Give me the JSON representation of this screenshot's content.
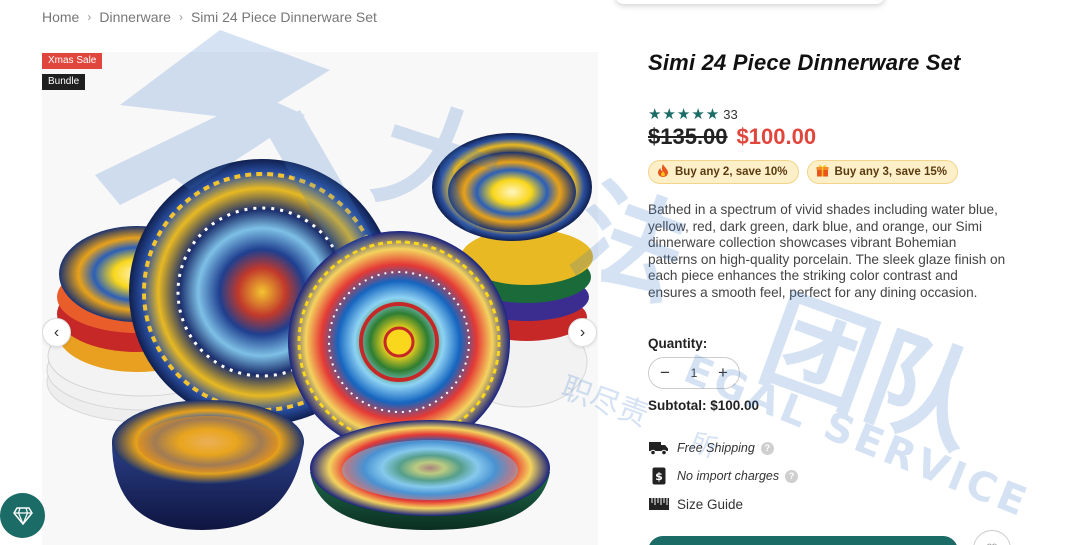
{
  "breadcrumb": {
    "items": [
      "Home",
      "Dinnerware"
    ],
    "current": "Simi 24 Piece Dinnerware Set"
  },
  "gallery": {
    "badges": {
      "sale": "Xmas Sale",
      "bundle": "Bundle"
    },
    "prev_icon": "chevron-left-icon",
    "next_icon": "chevron-right-icon"
  },
  "product": {
    "title": "Simi 24 Piece Dinnerware Set",
    "rating_value": 5,
    "stars": "★★★★★",
    "review_count": "33",
    "price_old": "$135.00",
    "price_new": "$100.00",
    "promos": [
      {
        "icon": "fire-icon",
        "label": "Buy any 2, save 10%"
      },
      {
        "icon": "gift-icon",
        "label": "Buy any 3, save 15%"
      }
    ],
    "description": "Bathed in a spectrum of vivid shades including water blue, yellow, red, dark green, dark blue, and orange, our Simi dinnerware collection showcases vibrant Bohemian patterns on high-quality porcelain. The sleek glaze finish on each piece enhances the striking color contrast and ensures a smooth feel, perfect for any dining occasion.",
    "quantity_label": "Quantity:",
    "quantity_value": "1",
    "subtotal": "Subtotal: $100.00",
    "features": [
      {
        "icon": "truck-icon",
        "label": "Free Shipping",
        "help": "?"
      },
      {
        "icon": "dollar-doc-icon",
        "label": "No import charges",
        "help": "?"
      },
      {
        "icon": "ruler-icon",
        "label": "Size Guide"
      }
    ]
  },
  "watermark": {
    "text_large": "大",
    "text_cn": "职尽责",
    "text_cn2": "所",
    "text_en": "EGAL SERVICE",
    "text_cn3": "团队"
  },
  "colors": {
    "accent": "#1b6b66",
    "sale_red": "#e0463c",
    "promo_bg": "#fdefc8",
    "watermark": "#3d7cc9"
  }
}
